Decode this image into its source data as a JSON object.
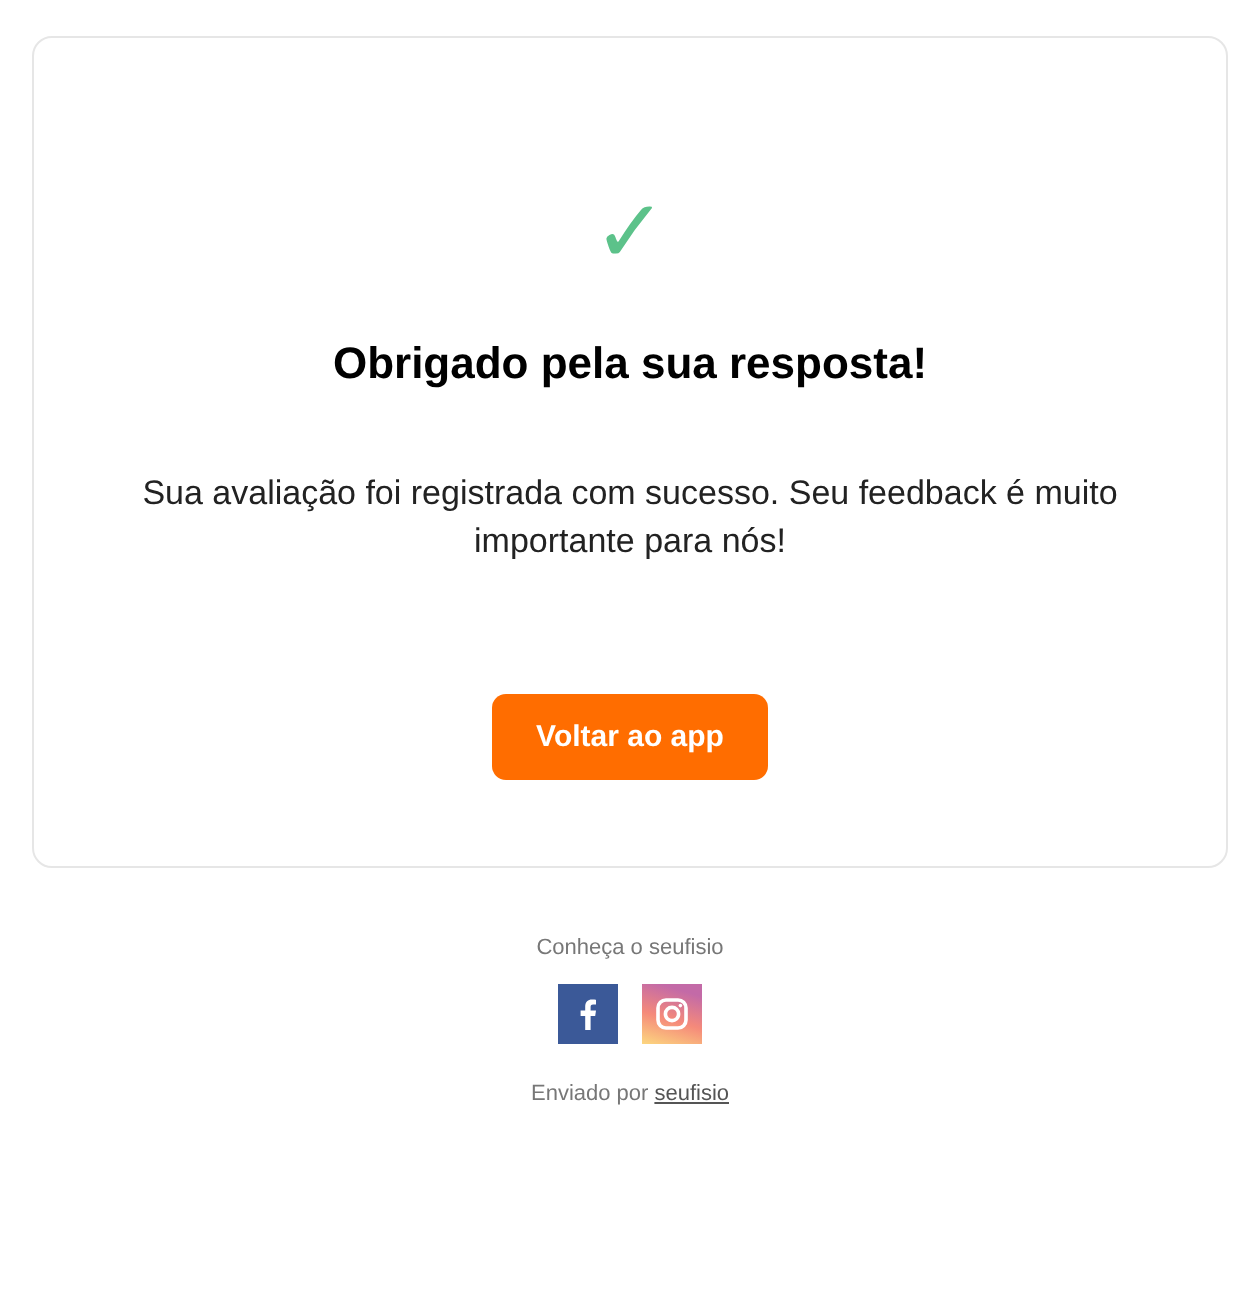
{
  "card": {
    "check_mark": "✓",
    "title": "Obrigado pela sua resposta!",
    "message": "Sua avaliação foi registrada com sucesso. Seu feedback é muito importante para nós!",
    "button": "Voltar ao app"
  },
  "footer": {
    "tagline": "Conheça o seufisio",
    "social": [
      {
        "kind": "facebook"
      },
      {
        "kind": "instagram"
      }
    ],
    "sent_by": "Enviado por",
    "sent_by_link": "seufisio"
  }
}
